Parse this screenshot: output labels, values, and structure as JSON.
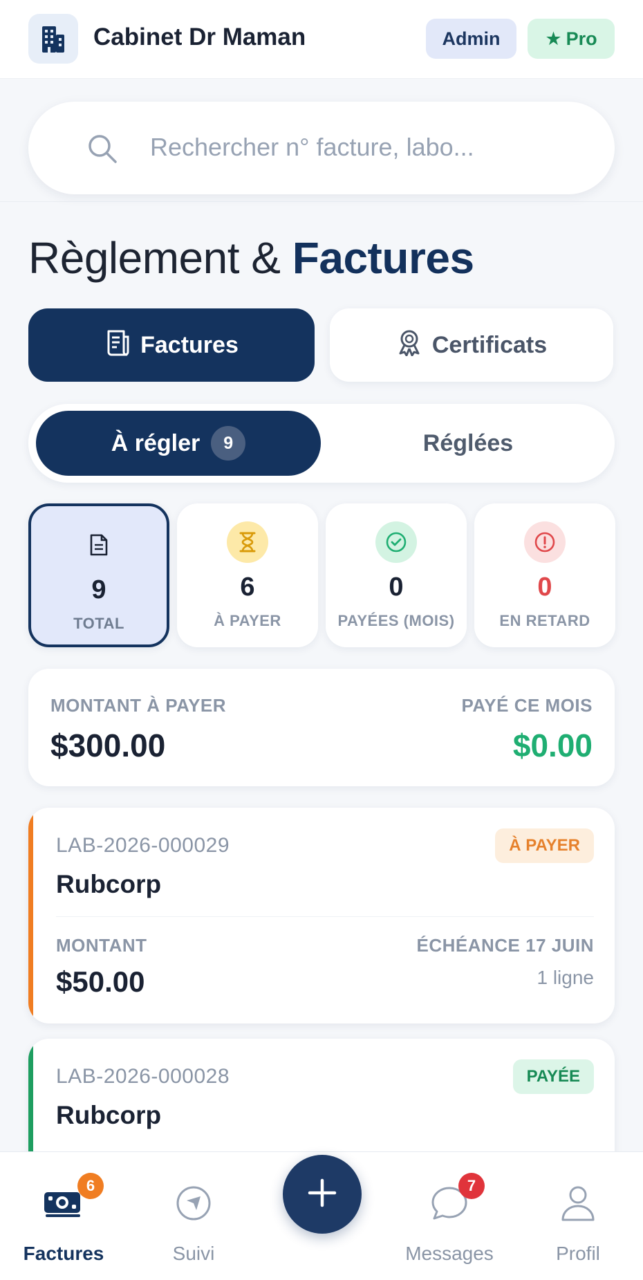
{
  "header": {
    "title": "Cabinet Dr Maman",
    "brand_icon": "building-icon",
    "role_badge": "Admin",
    "plan_badge": "Pro",
    "plan_icon": "star-icon"
  },
  "search": {
    "placeholder": "Rechercher n° facture, labo...",
    "value": ""
  },
  "page": {
    "title_light": "Règlement &",
    "title_bold": "Factures"
  },
  "main_tabs": [
    {
      "label": "Factures",
      "icon": "invoice-icon",
      "active": true
    },
    {
      "label": "Certificats",
      "icon": "certificate-icon",
      "active": false
    }
  ],
  "segment": {
    "active_label": "À régler",
    "active_count": "9",
    "inactive_label": "Réglées"
  },
  "stats": [
    {
      "value": "9",
      "label": "TOTAL",
      "icon": "document-icon",
      "color": "#1a2233"
    },
    {
      "value": "6",
      "label": "À PAYER",
      "icon": "hourglass-icon",
      "color": "#1a2233"
    },
    {
      "value": "0",
      "label": "PAYÉES (MOIS)",
      "icon": "check-circle-icon",
      "color": "#1a2233"
    },
    {
      "value": "0",
      "label": "EN RETARD",
      "icon": "alert-circle-icon",
      "color": "#e0484b"
    }
  ],
  "summary": {
    "due_label": "MONTANT À PAYER",
    "due_value": "$300.00",
    "paid_label": "PAYÉ CE MOIS",
    "paid_value": "$0.00",
    "paid_color": "#1fae72"
  },
  "invoices": [
    {
      "number": "LAB-2026-000029",
      "lab": "Rubcorp",
      "status": "À PAYER",
      "status_color": "#e6812c",
      "status_bg": "#fdeedd",
      "accent": "#f07d22",
      "amount_label": "MONTANT",
      "amount": "$50.00",
      "due": "ÉCHÉANCE 17 JUIN",
      "lines": "1 ligne"
    },
    {
      "number": "LAB-2026-000028",
      "lab": "Rubcorp",
      "status": "PAYÉE",
      "status_color": "#178a55",
      "status_bg": "#dcf5e8",
      "accent": "#1e9e60"
    }
  ],
  "bottom_nav": [
    {
      "label": "Factures",
      "icon": "money-icon",
      "badge": "6",
      "badge_color": "#f07d22",
      "active": true
    },
    {
      "label": "Suivi",
      "icon": "navigation-icon",
      "active": false
    },
    {
      "label": "Messages",
      "icon": "chat-icon",
      "badge": "7",
      "badge_color": "#e0343b",
      "active": false
    },
    {
      "label": "Profil",
      "icon": "user-icon",
      "active": false
    }
  ],
  "fab": {
    "icon": "plus-icon"
  }
}
